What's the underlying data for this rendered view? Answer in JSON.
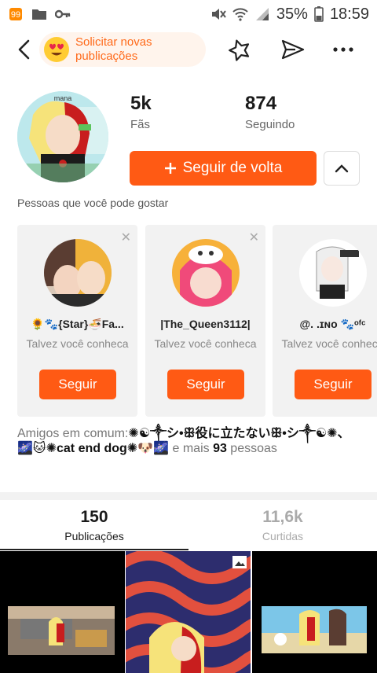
{
  "status_bar": {
    "battery": "35%",
    "time": "18:59",
    "icons": [
      "app-icon",
      "folder-icon",
      "key-icon",
      "mute-icon",
      "wifi-icon",
      "signal-icon",
      "battery-icon"
    ]
  },
  "header": {
    "back_icon": "back-arrow-icon",
    "banner_text": "Solicitar novas publicações",
    "banner_icon": "heart-eyes-emoji-icon",
    "actions": [
      "star-icon",
      "share-icon",
      "more-icon"
    ]
  },
  "profile": {
    "followers_count": "5k",
    "followers_label": "Fãs",
    "following_count": "874",
    "following_label": "Seguindo",
    "follow_back_label": "Seguir de volta",
    "avatar_watermark": "mana"
  },
  "suggestions": {
    "title": "Pessoas que você pode gostar",
    "cards": [
      {
        "name": "🌻🐾{Star}🍜Fa...",
        "subtitle": "Talvez você conheca",
        "button": "Seguir"
      },
      {
        "name": "|The_Queen3112|",
        "subtitle": "Talvez você conheca",
        "button": "Seguir"
      },
      {
        "name": "@. .ɪɴᴏ 🐾ᵒᶠᶜ",
        "subtitle": "Talvez você conheca",
        "button": "Seguir"
      }
    ]
  },
  "mutual": {
    "prefix": "Amigos em comum:",
    "names": "✺☯︎༒シ•ꕥ役に立たないꕥ•シ༒☯︎✺、🌌🐱✺cat end dog✺🐶🌌",
    "suffix_before": " e mais ",
    "count": "93",
    "suffix_after": " pessoas"
  },
  "tabs": [
    {
      "count": "150",
      "label": "Publicações",
      "active": true
    },
    {
      "count": "11,6k",
      "label": "Curtidas",
      "active": false
    }
  ],
  "colors": {
    "accent": "#ff5a14",
    "banner_text": "#ff6a1a",
    "banner_bg": "#fff4ec"
  }
}
